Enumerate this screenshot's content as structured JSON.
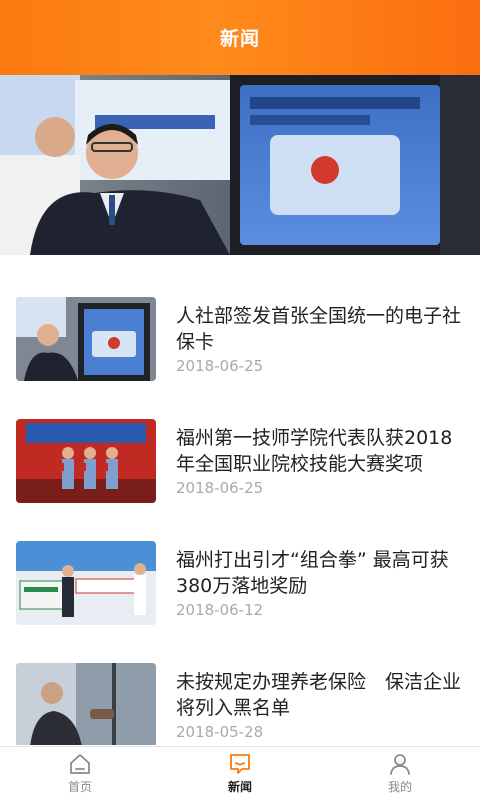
{
  "header": {
    "title": "新闻"
  },
  "banner": {
    "slide_count": 2,
    "active_index": 0,
    "accent": "#fb7a12"
  },
  "news": [
    {
      "title": "人社部签发首张全国统一的电子社保卡",
      "date": "2018-06-25",
      "thumb": "ceremony-screen"
    },
    {
      "title": "福州第一技师学院代表队获2018年全国职业院校技能大赛奖项",
      "date": "2018-06-25",
      "thumb": "award-stage"
    },
    {
      "title": "福州打出引才“组合拳” 最高可获380万落地奖励",
      "date": "2018-06-12",
      "thumb": "talent-event"
    },
    {
      "title": "未按规定办理养老保险　保洁企业将列入黑名单",
      "date": "2018-05-28",
      "thumb": "window-cleaner"
    }
  ],
  "tabbar": {
    "items": [
      {
        "label": "首页",
        "icon": "home-icon",
        "active": false
      },
      {
        "label": "新闻",
        "icon": "news-chat-icon",
        "active": true
      },
      {
        "label": "我的",
        "icon": "user-icon",
        "active": false
      }
    ],
    "active_color": "#fb7a12"
  }
}
